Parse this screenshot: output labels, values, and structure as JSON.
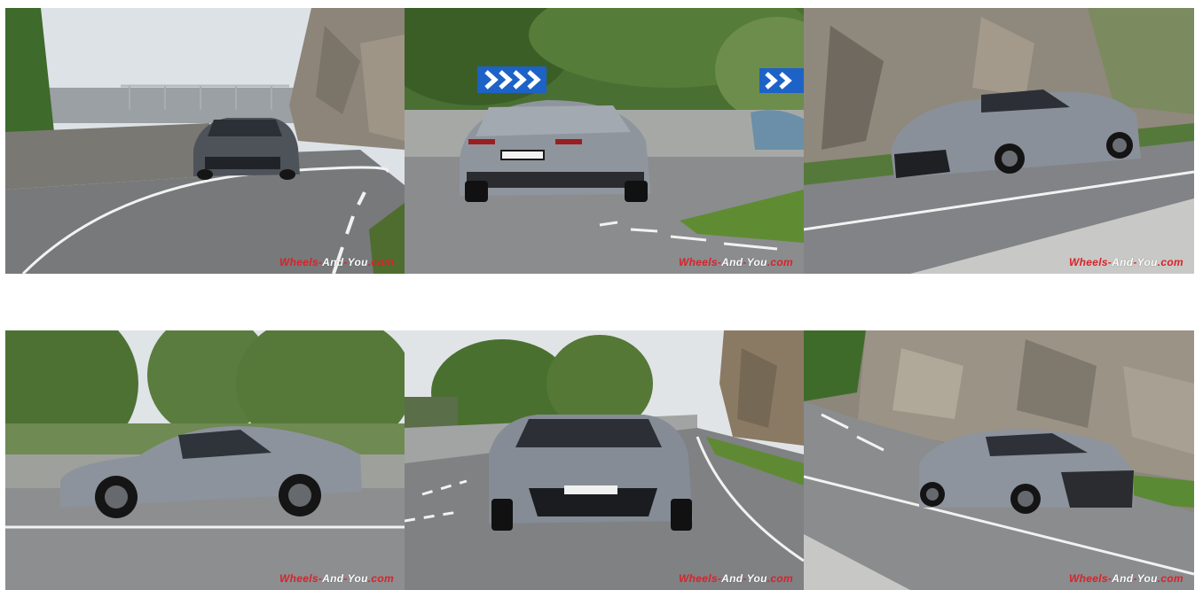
{
  "gallery": {
    "photos": [
      {
        "subject": "car-front-three-quarter-curve",
        "watermark": {
          "a": "Wheels-",
          "b": "And",
          "c": "-",
          "d": "You",
          "e": ".com"
        }
      },
      {
        "subject": "car-rear-view-chevrons",
        "watermark": {
          "a": "Wheels-",
          "b": "And",
          "c": "-",
          "d": "You",
          "e": ".com"
        }
      },
      {
        "subject": "car-front-three-quarter-rock",
        "watermark": {
          "a": "Wheels-",
          "b": "And",
          "c": "-",
          "d": "You",
          "e": ".com"
        }
      },
      {
        "subject": "car-side-profile",
        "watermark": {
          "a": "Wheels-",
          "b": "And",
          "c": "-",
          "d": "You",
          "e": ".com"
        }
      },
      {
        "subject": "car-front-view",
        "watermark": {
          "a": "Wheels-",
          "b": "And",
          "c": "-",
          "d": "You",
          "e": ".com"
        }
      },
      {
        "subject": "car-rear-three-quarter-rock",
        "watermark": {
          "a": "Wheels-",
          "b": "And",
          "c": "-",
          "d": "You",
          "e": ".com"
        }
      }
    ]
  },
  "colors": {
    "car_body": "#8c939c",
    "road": "#7d7f82",
    "rock": "#8a8378",
    "foliage": "#3f6b2a",
    "sky": "#dfe3e6",
    "watermark_red": "#d8232a"
  }
}
